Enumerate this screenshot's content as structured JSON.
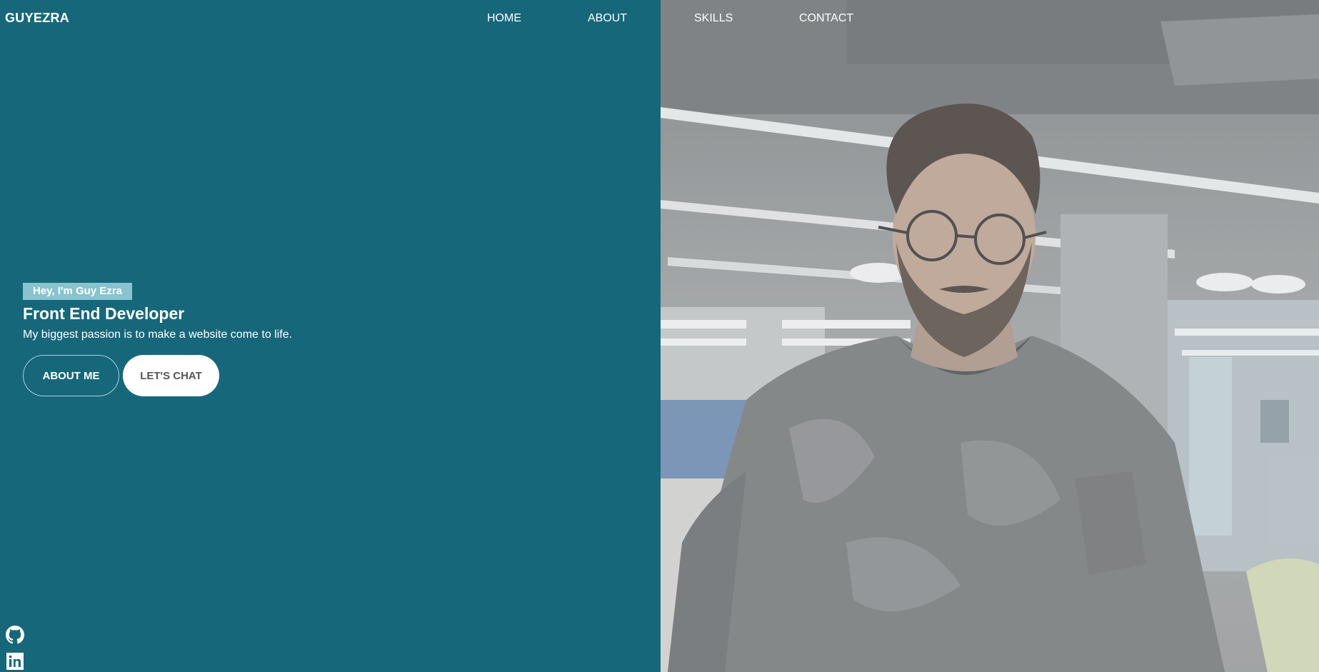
{
  "header": {
    "logo": "GUYEZRA",
    "nav": [
      "HOME",
      "ABOUT",
      "SKILLS",
      "CONTACT"
    ]
  },
  "hero": {
    "greeting": "Hey, I'm Guy Ezra",
    "title": "Front End Developer",
    "tagline": "My biggest passion is to make a website come to life.",
    "buttons": {
      "about": "ABOUT ME",
      "chat": "LET'S CHAT"
    }
  },
  "social": {
    "icons": [
      "github-icon",
      "linkedin-icon"
    ]
  },
  "colors": {
    "background": "#17677b",
    "greeting_bg": "#88c3cf",
    "button_solid_bg": "#ffffff",
    "button_solid_text": "#555555"
  }
}
